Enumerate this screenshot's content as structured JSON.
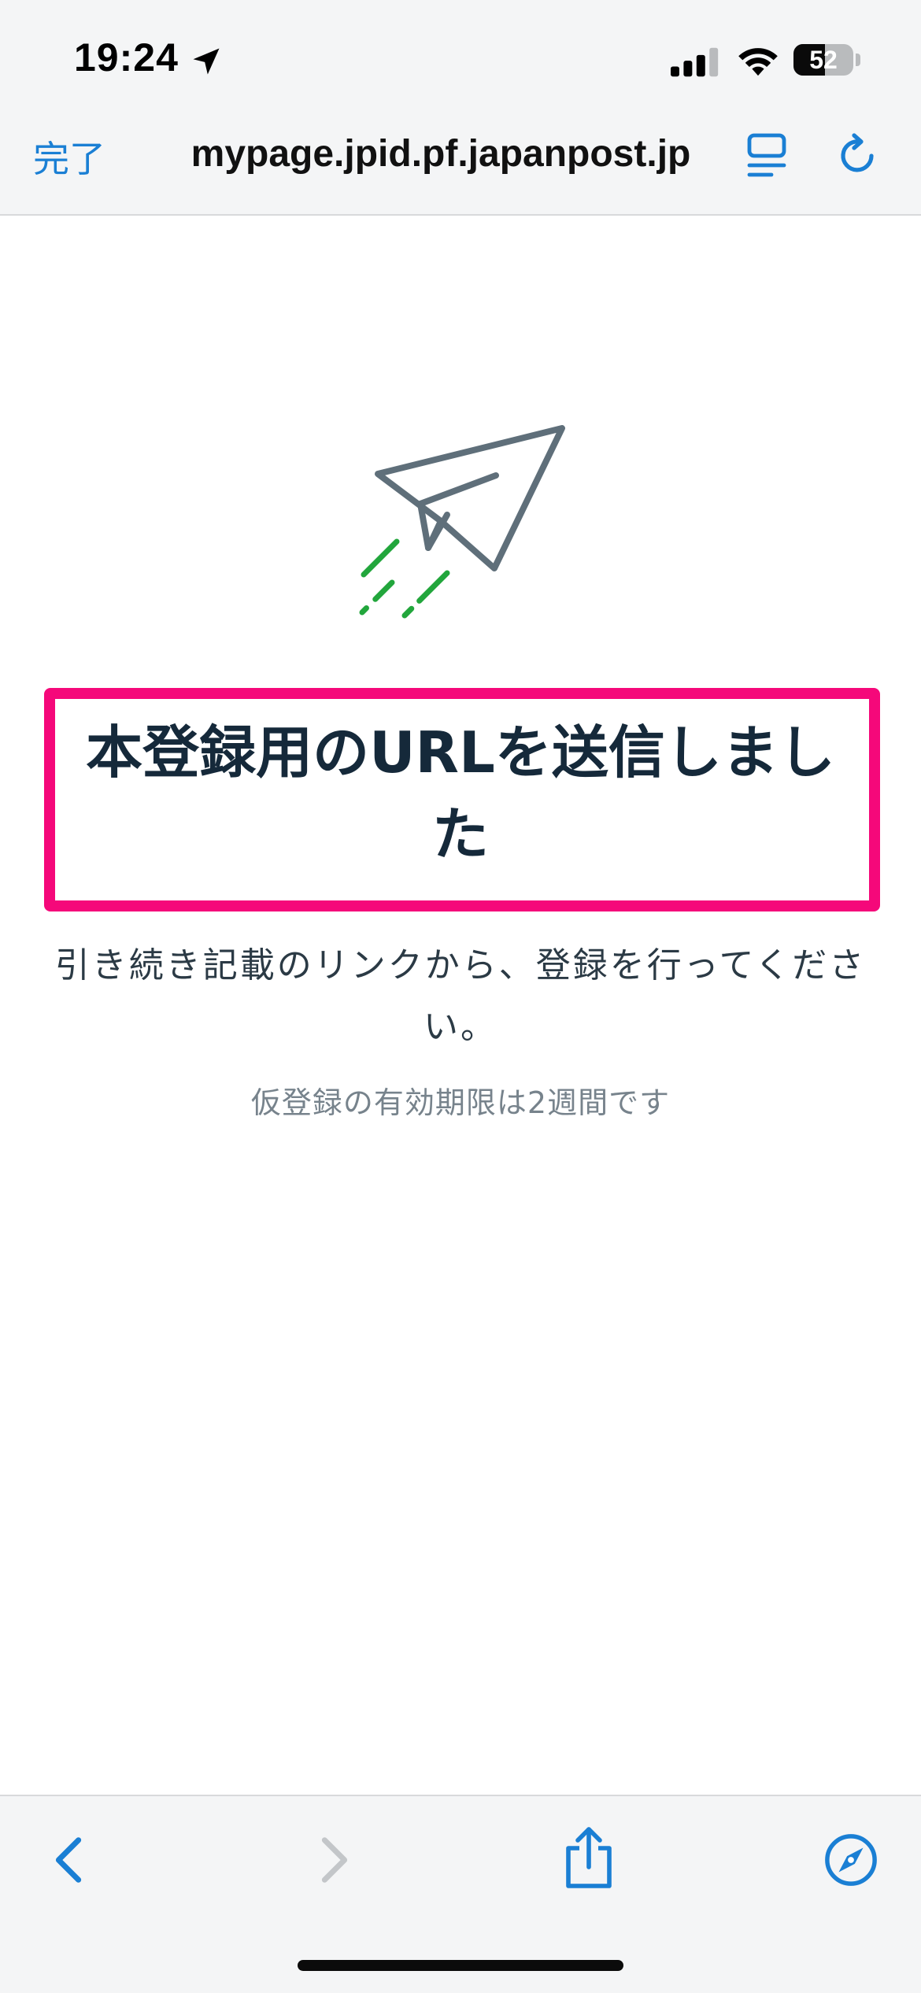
{
  "status_bar": {
    "time": "19:24",
    "battery_level": "52",
    "icons": [
      "location-arrow-icon",
      "cellular-signal-icon",
      "wifi-icon",
      "battery-icon"
    ]
  },
  "browser_nav": {
    "done_label": "完了",
    "url": "mypage.jpid.pf.japanpost.jp",
    "icons": [
      "reader-icon",
      "reload-icon"
    ]
  },
  "content": {
    "illustration": "paper-plane-icon",
    "heading": "本登録用のURLを送信しました",
    "instruction": "引き続き記載のリンクから、登録を行ってください。",
    "expiry_note": "仮登録の有効期限は2週間です"
  },
  "toolbar": {
    "icons": [
      "back-icon",
      "forward-icon",
      "share-icon",
      "compass-icon"
    ]
  },
  "colors": {
    "accent": "#1a7fd4",
    "highlight": "#f5087a",
    "heading": "#15293a",
    "plane_stroke": "#5f6f7a",
    "speed_lines": "#22a63c"
  }
}
